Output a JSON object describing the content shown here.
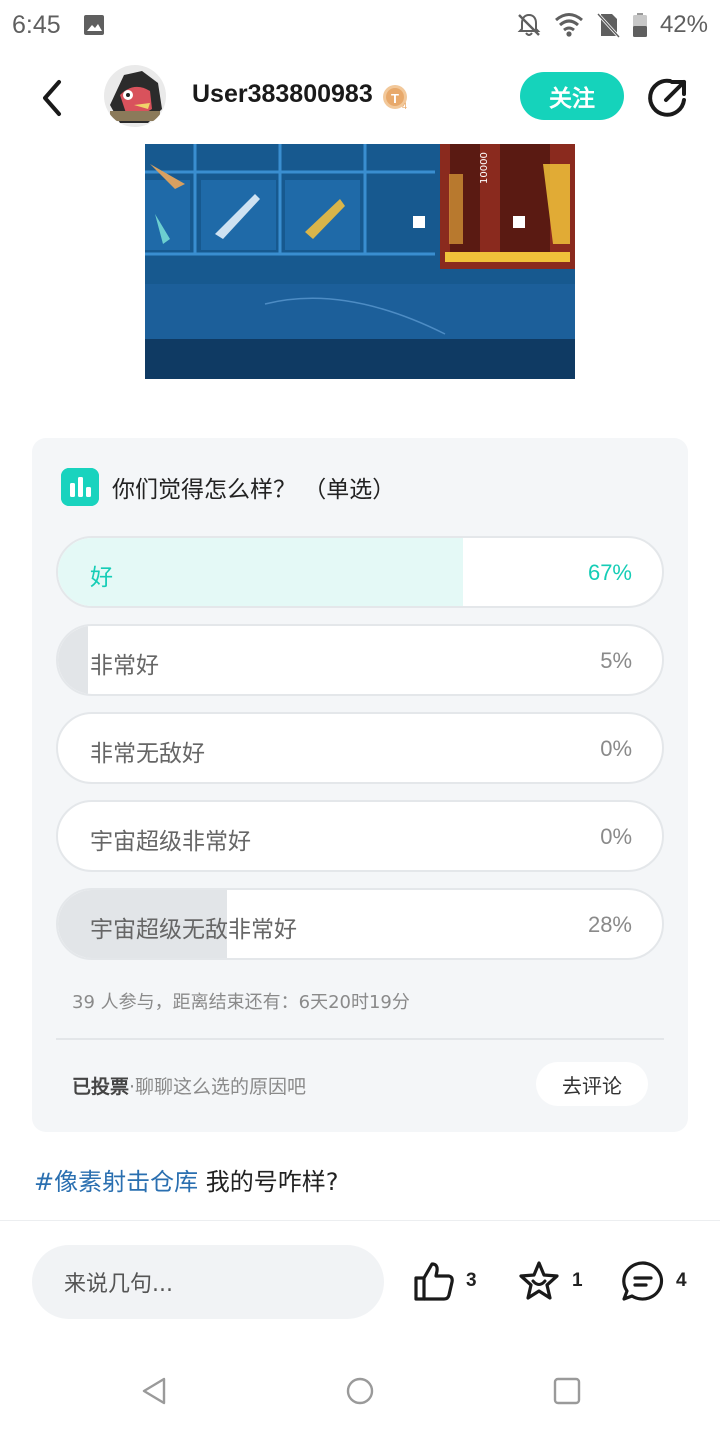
{
  "status_bar": {
    "time": "6:45",
    "battery": "42%",
    "icons": [
      "image-icon",
      "bell-off-icon",
      "wifi-icon",
      "no-sim-icon",
      "battery-icon"
    ]
  },
  "header": {
    "username": "User383800983",
    "follow_label": "关注",
    "icons": [
      "back-icon",
      "avatar",
      "level-badge-icon",
      "share-icon"
    ]
  },
  "poll": {
    "question": "你们觉得怎么样？ （单选）",
    "options": [
      {
        "label": "好",
        "percent_text": "67%",
        "percent": 67,
        "selected": true
      },
      {
        "label": "非常好",
        "percent_text": "5%",
        "percent": 5,
        "selected": false
      },
      {
        "label": "非常无敌好",
        "percent_text": "0%",
        "percent": 0,
        "selected": false
      },
      {
        "label": "宇宙超级非常好",
        "percent_text": "0%",
        "percent": 0,
        "selected": false
      },
      {
        "label": "宇宙超级无敌非常好",
        "percent_text": "28%",
        "percent": 28,
        "selected": false
      }
    ],
    "meta": "39 人参与，距离结束还有：6天20时19分",
    "voted_label": "已投票",
    "voted_hint": "·聊聊这么选的原因吧",
    "comment_label": "去评论",
    "colors": {
      "selected_fill": "#e4f9f6",
      "other_fill": "#e2e5e8",
      "accent": "#15cdb6"
    }
  },
  "post": {
    "topic": "#像素射击仓库",
    "text": " 我的号咋样?"
  },
  "bottom_bar": {
    "input_placeholder": "来说几句...",
    "like_count": "3",
    "favorite_count": "1",
    "comment_count": "4"
  }
}
